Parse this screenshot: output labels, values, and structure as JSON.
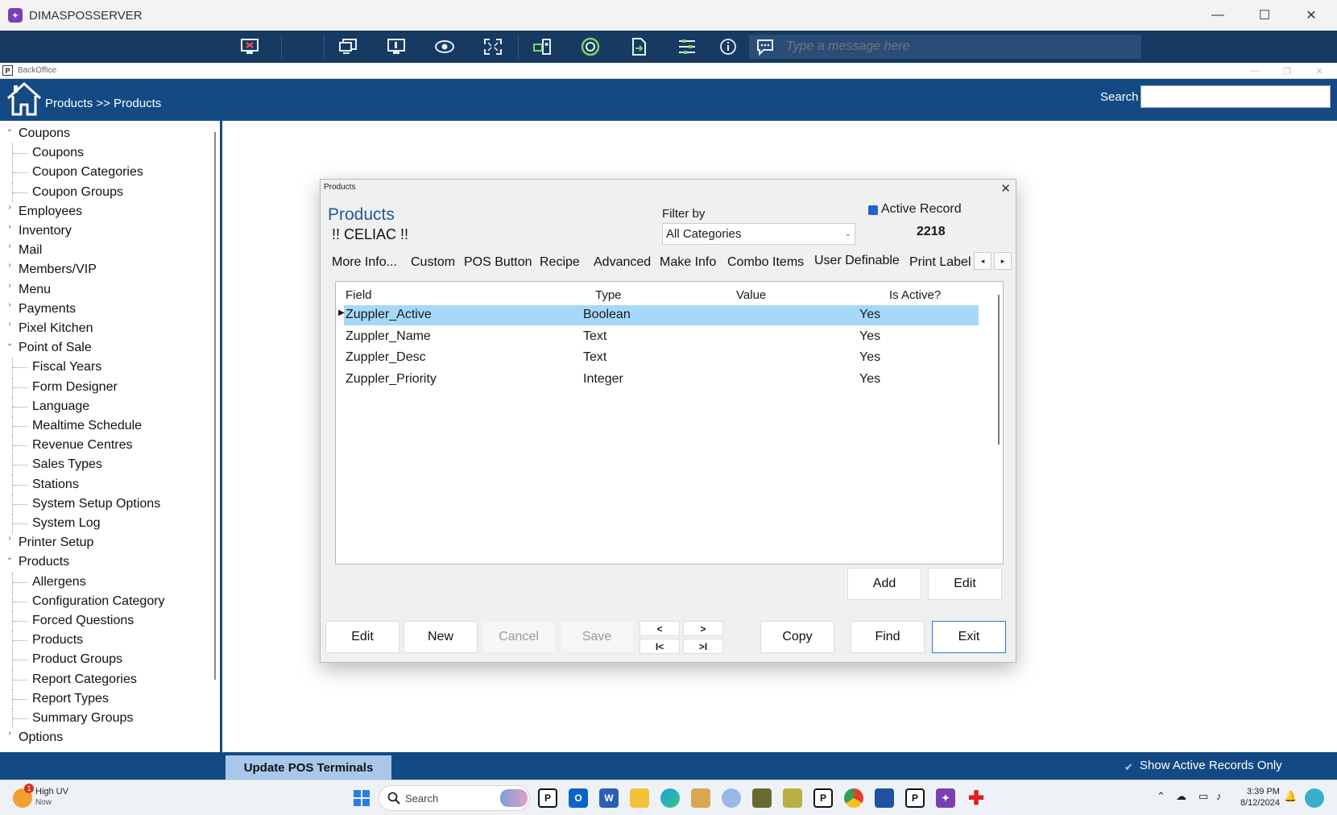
{
  "window": {
    "title": "DIMASPOSSERVER",
    "minimize": "—",
    "maximize": "☐",
    "close": "✕"
  },
  "remote_toolbar": {
    "message_placeholder": "Type a message here"
  },
  "backoffice": {
    "title": "BackOffice"
  },
  "header": {
    "breadcrumb": "Products >> Products",
    "search_label": "Search"
  },
  "sidebar": {
    "items": [
      {
        "label": "Coupons",
        "level": 0,
        "expanded": true
      },
      {
        "label": "Coupons",
        "level": 1
      },
      {
        "label": "Coupon Categories",
        "level": 1
      },
      {
        "label": "Coupon Groups",
        "level": 1
      },
      {
        "label": "Employees",
        "level": 0,
        "expanded": false
      },
      {
        "label": "Inventory",
        "level": 0,
        "expanded": false
      },
      {
        "label": "Mail",
        "level": 0,
        "expanded": false
      },
      {
        "label": "Members/VIP",
        "level": 0,
        "expanded": false
      },
      {
        "label": "Menu",
        "level": 0,
        "expanded": false
      },
      {
        "label": "Payments",
        "level": 0,
        "expanded": false
      },
      {
        "label": "Pixel Kitchen",
        "level": 0,
        "expanded": false
      },
      {
        "label": "Point of Sale",
        "level": 0,
        "expanded": true
      },
      {
        "label": "Fiscal Years",
        "level": 1
      },
      {
        "label": "Form Designer",
        "level": 1
      },
      {
        "label": "Language",
        "level": 1
      },
      {
        "label": "Mealtime Schedule",
        "level": 1
      },
      {
        "label": "Revenue Centres",
        "level": 1
      },
      {
        "label": "Sales Types",
        "level": 1
      },
      {
        "label": "Stations",
        "level": 1
      },
      {
        "label": "System Setup Options",
        "level": 1
      },
      {
        "label": "System Log",
        "level": 1
      },
      {
        "label": "Printer Setup",
        "level": 0,
        "expanded": false
      },
      {
        "label": "Products",
        "level": 0,
        "expanded": true
      },
      {
        "label": "Allergens",
        "level": 1
      },
      {
        "label": "Configuration Category",
        "level": 1
      },
      {
        "label": "Forced Questions",
        "level": 1
      },
      {
        "label": "Products",
        "level": 1
      },
      {
        "label": "Product Groups",
        "level": 1
      },
      {
        "label": "Report Categories",
        "level": 1
      },
      {
        "label": "Report Types",
        "level": 1
      },
      {
        "label": "Summary Groups",
        "level": 1
      },
      {
        "label": "Options",
        "level": 0,
        "expanded": false
      }
    ]
  },
  "dialog": {
    "title": "Products",
    "heading": "Products",
    "subheading": "!! CELIAC !!",
    "filter_label": "Filter by",
    "filter_value": "All Categories",
    "active_record_label": "Active Record",
    "active_record_checked": true,
    "record_number": "2218",
    "tabs": [
      "More Info...",
      "Custom",
      "POS Button",
      "Recipe",
      "Advanced",
      "Make Info",
      "Combo Items",
      "User Definable",
      "Print Label"
    ],
    "active_tab": "User Definable",
    "tab_prev": "◂",
    "tab_next": "▸",
    "grid": {
      "columns": [
        "Field",
        "Type",
        "Value",
        "Is Active?"
      ],
      "rows": [
        [
          "Zuppler_Active",
          "Boolean",
          "",
          "Yes"
        ],
        [
          "Zuppler_Name",
          "Text",
          "",
          "Yes"
        ],
        [
          "Zuppler_Desc",
          "Text",
          "",
          "Yes"
        ],
        [
          "Zuppler_Priority",
          "Integer",
          "",
          "Yes"
        ]
      ],
      "selected_row": 0,
      "row_pointer": "▶"
    },
    "grid_buttons": {
      "add": "Add",
      "edit": "Edit"
    },
    "buttons": {
      "edit": "Edit",
      "new": "New",
      "cancel": "Cancel",
      "save": "Save",
      "copy": "Copy",
      "find": "Find",
      "exit": "Exit"
    },
    "nav": {
      "prev": "<",
      "next": ">",
      "first": "I<",
      "last": ">I"
    }
  },
  "bottom_bar": {
    "update_label": "Update POS Terminals",
    "show_active_label": "Show Active Records Only",
    "show_active_checked": true
  },
  "taskbar": {
    "weather_label": "High UV",
    "weather_sub": "Now",
    "weather_badge": "1",
    "search_label": "Search",
    "time": "3:39 PM",
    "date": "8/12/2024"
  },
  "colors": {
    "header": "#134a84",
    "toolbar": "#173a63",
    "selection": "#a6d8fa",
    "heading": "#1f5b96"
  }
}
